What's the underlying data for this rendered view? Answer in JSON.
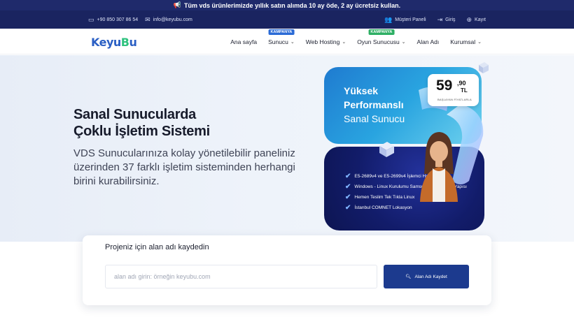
{
  "announcement": {
    "icon": "megaphone-icon",
    "text": "Tüm vds ürünlerimizde yıllık satın alımda 10 ay öde, 2 ay ücretsiz kullan."
  },
  "topbar": {
    "phone": "+90 850 307 86 54",
    "email": "info@keyubu.com",
    "customer_panel": "Müşteri Paneli",
    "login": "Giriş",
    "register": "Kayıt"
  },
  "header": {
    "logo": {
      "part1": "Keyu",
      "part2": "B",
      "part3": "u"
    },
    "nav": {
      "home": "Ana sayfa",
      "server": "Sunucu",
      "server_badge": "KAMPANYA",
      "webhosting": "Web Hosting",
      "game": "Oyun Sunucusu",
      "game_badge": "KAMPANYA",
      "domain": "Alan Adı",
      "corporate": "Kurumsal"
    }
  },
  "hero": {
    "title_line1": "Sanal Sunucularda",
    "title_line2": "Çoklu İşletim Sistemi",
    "description": "VDS Sunucularınıza kolay yönetilebilir paneliniz üzerinden 37 farklı işletim sisteminden herhangi birini kurabilirsiniz."
  },
  "promo": {
    "line1": "Yüksek",
    "line2": "Performanslı",
    "line3": "Sanal Sunucu",
    "price_main": "59",
    "price_cents": ",90",
    "price_currency": "TL",
    "price_note": "BAŞLAYAN FİYATLARLA",
    "features": [
      "E5-2689v4 ve E5-2699v4 İşlemci Hızlı Kurulum",
      "Windows - Linux Kurulumu Samsung NVMe Disk Yapısı",
      "Hemen Teslim Tek Tıkla Linux",
      "İstanbul COMNET Lokasyon"
    ]
  },
  "domain": {
    "title": "Projeniz için alan adı kaydedin",
    "placeholder": "alan adı girin: örneğin keyubu.com",
    "button": "Alan Adı Kaydet"
  },
  "colors": {
    "navy": "#1a2460",
    "brand_blue": "#2a5fc4",
    "brand_green": "#2ec27e",
    "button": "#1c3a8e"
  }
}
